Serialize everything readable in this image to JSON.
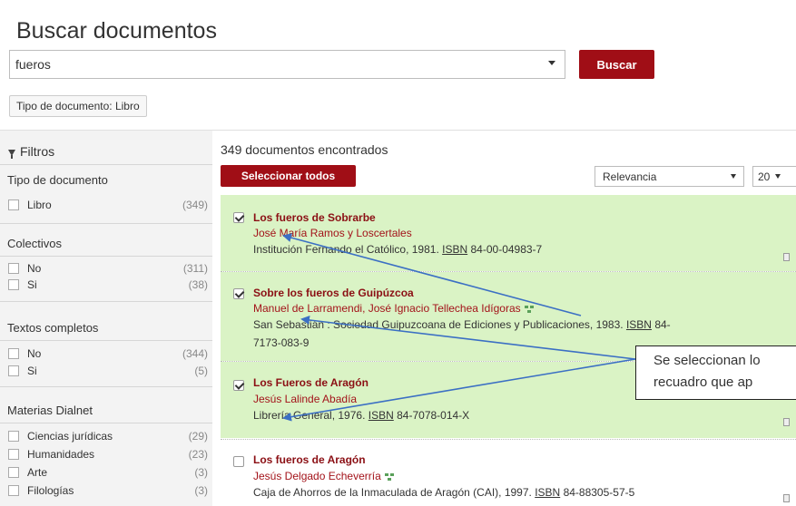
{
  "header": {
    "title": "Buscar documentos",
    "search_value": "fueros",
    "search_button": "Buscar",
    "filter_chip": "Tipo de documento: Libro"
  },
  "sidebar": {
    "title": "Filtros",
    "sections": [
      {
        "title": "Tipo de documento",
        "items": [
          {
            "label": "Libro",
            "count": "(349)"
          }
        ]
      },
      {
        "title": "Colectivos",
        "items": [
          {
            "label": "No",
            "count": "(311)"
          },
          {
            "label": "Si",
            "count": "(38)"
          }
        ]
      },
      {
        "title": "Textos completos",
        "items": [
          {
            "label": "No",
            "count": "(344)"
          },
          {
            "label": "Si",
            "count": "(5)"
          }
        ]
      },
      {
        "title": "Materias Dialnet",
        "items": [
          {
            "label": "Ciencias jurídicas",
            "count": "(29)"
          },
          {
            "label": "Humanidades",
            "count": "(23)"
          },
          {
            "label": "Arte",
            "count": "(3)"
          },
          {
            "label": "Filologías",
            "count": "(3)"
          }
        ]
      }
    ]
  },
  "results": {
    "count_text": "349 documentos encontrados",
    "select_all": "Seleccionar todos",
    "sort": "Relevancia",
    "per_page": "20",
    "items": [
      {
        "checked": true,
        "title": "Los fueros de Sobrarbe",
        "author": "José María Ramos y Loscertales",
        "pub": "Institución Fernando el Católico, 1981.",
        "isbn_label": "ISBN",
        "isbn": "84-00-04983-7"
      },
      {
        "checked": true,
        "title": "Sobre los fueros de Guipúzcoa",
        "author": "Manuel de Larramendi, José Ignacio Tellechea Idígoras",
        "pub": "San Sebastián : Sociedad Guipuzcoana de Ediciones y Publicaciones, 1983.",
        "isbn_label": "ISBN",
        "isbn": "84-",
        "isbn_cont": "7173-083-9"
      },
      {
        "checked": true,
        "title": "Los Fueros de Aragón",
        "author": "Jesús Lalinde Abadía",
        "pub": "Librería General, 1976.",
        "isbn_label": "ISBN",
        "isbn": "84-7078-014-X"
      },
      {
        "checked": false,
        "title": "Los fueros de Aragón",
        "author": "Jesús Delgado Echeverría",
        "pub": "Caja de Ahorros de la Inmaculada de Aragón (CAI), 1997.",
        "isbn_label": "ISBN",
        "isbn": "84-88305-57-5"
      }
    ]
  },
  "callout": {
    "line1": "Se seleccionan lo",
    "line2": "recuadro que ap"
  },
  "colors": {
    "accent": "#a00e16",
    "selected_bg": "#daf3c5",
    "arrow": "#3b6fc4"
  }
}
